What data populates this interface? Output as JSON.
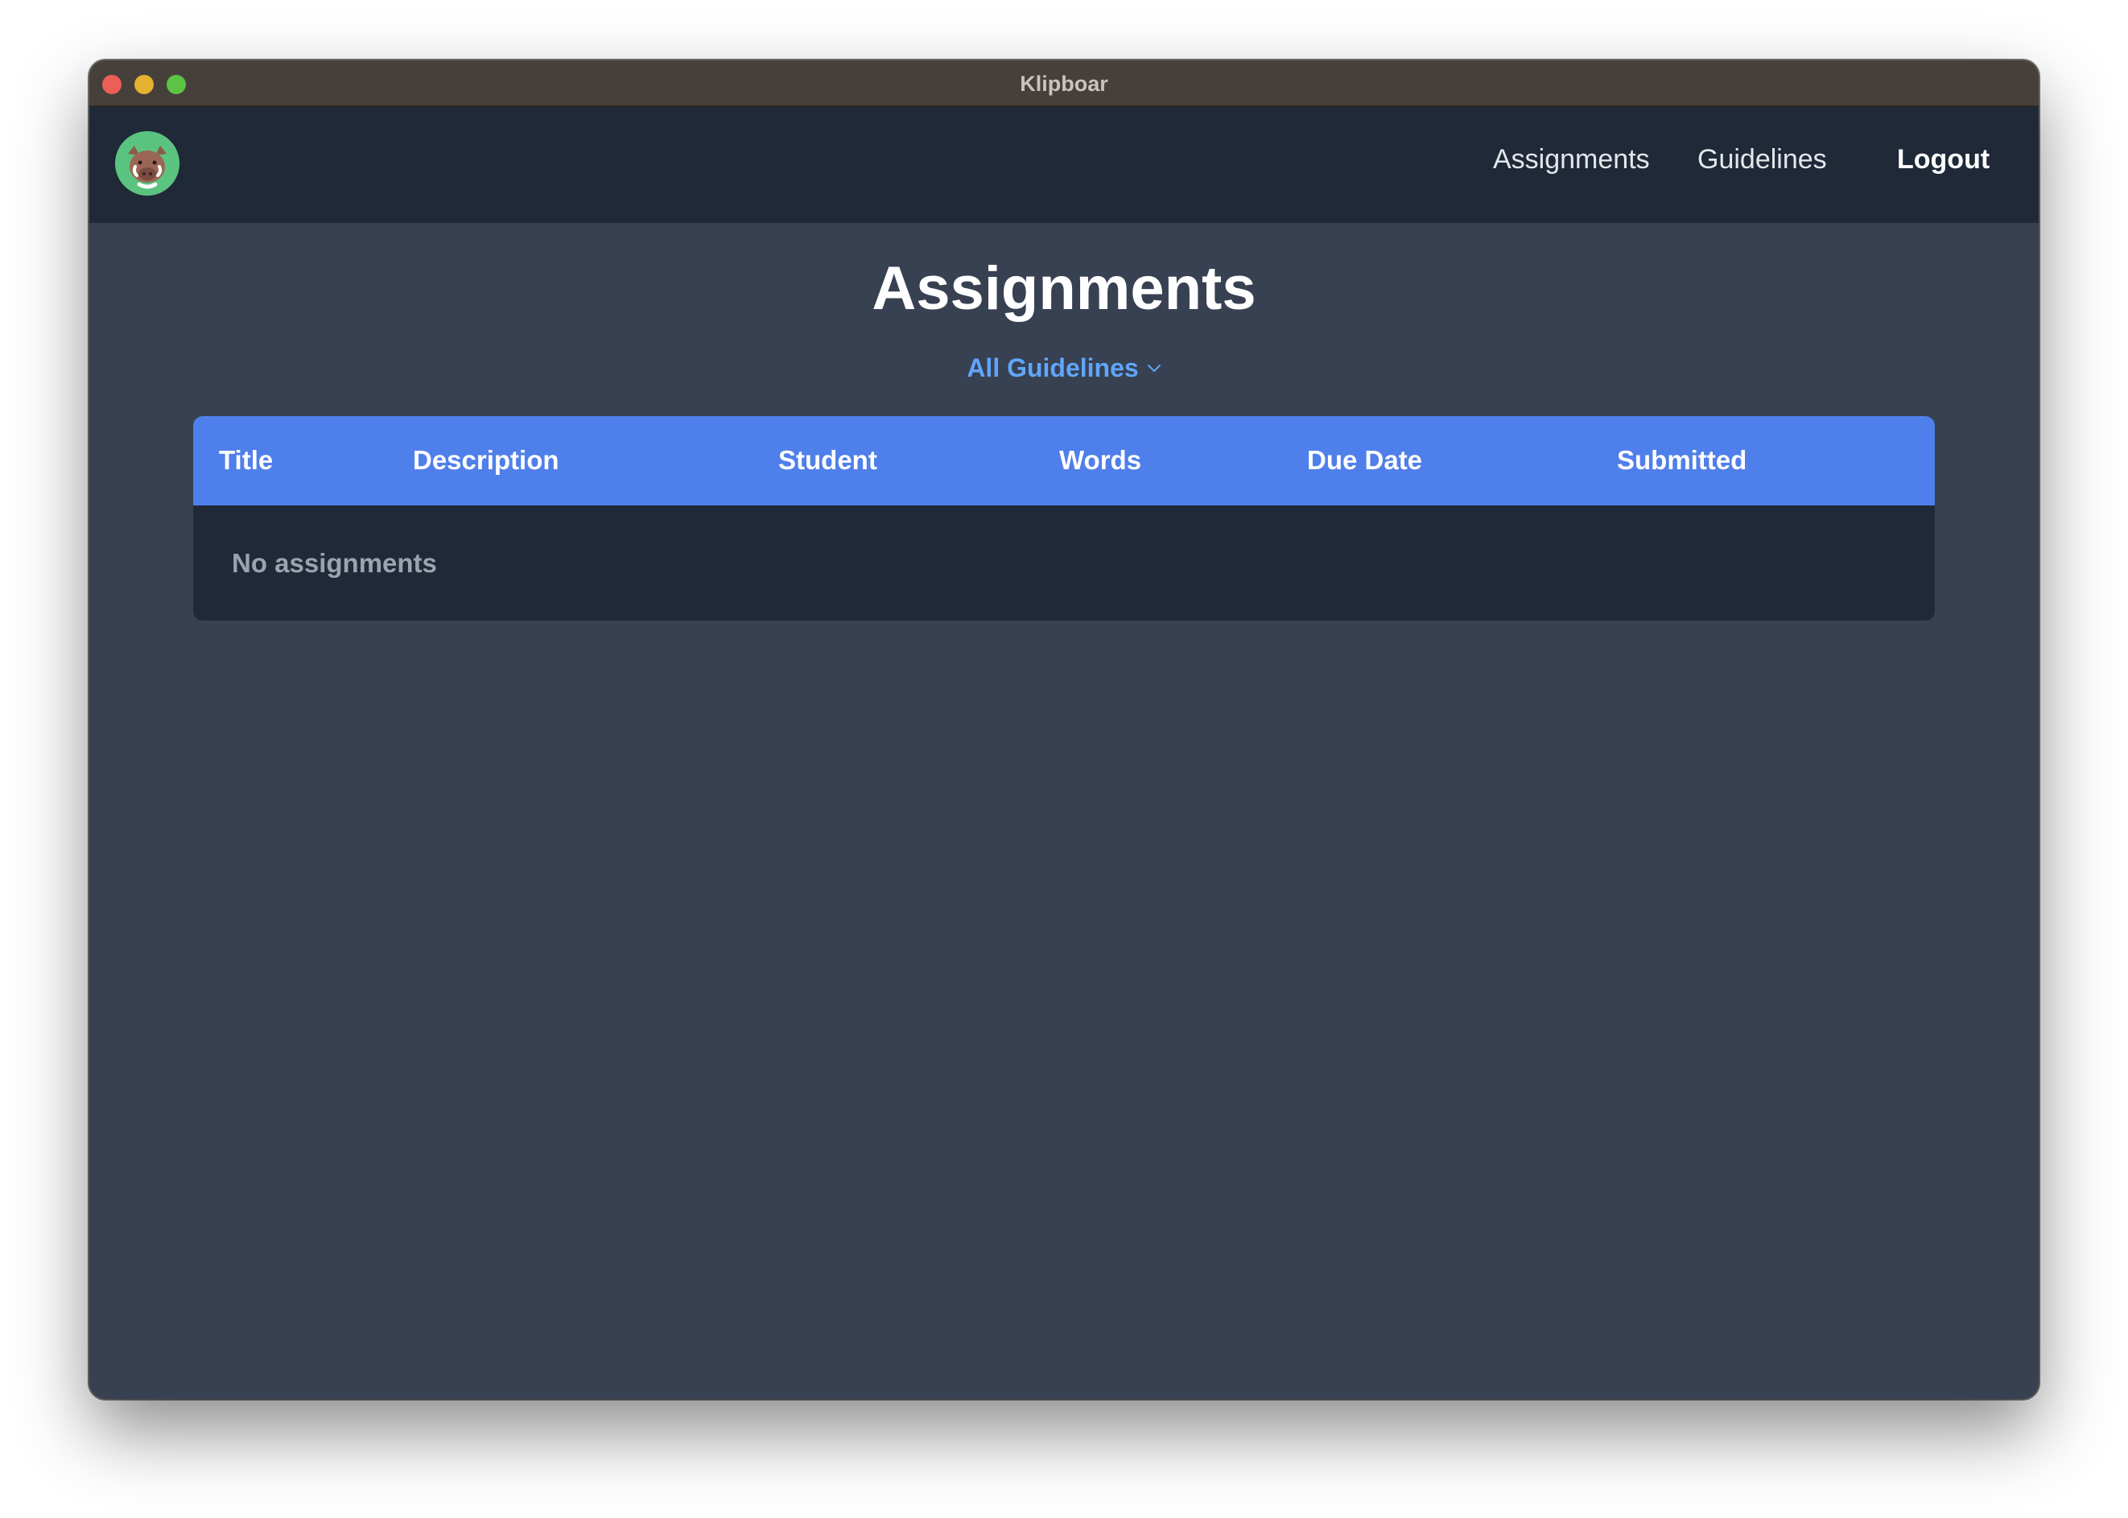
{
  "window": {
    "title": "Klipboar"
  },
  "navbar": {
    "links": [
      {
        "label": "Assignments"
      },
      {
        "label": "Guidelines"
      },
      {
        "label": "Logout"
      }
    ]
  },
  "page": {
    "title": "Assignments",
    "filter_label": "All Guidelines"
  },
  "table": {
    "columns": [
      "Title",
      "Description",
      "Student",
      "Words",
      "Due Date",
      "Submitted"
    ],
    "empty_message": "No assignments"
  },
  "colors": {
    "navbar_bg": "#1f2937",
    "page_bg": "#374151",
    "table_header_bg": "#4f7fea",
    "filter_accent": "#60a5fa",
    "logo_bg": "#5ac37f"
  },
  "icons": {
    "logo": "boar-logo-icon",
    "filter_toggle": "chevron-down-icon"
  }
}
